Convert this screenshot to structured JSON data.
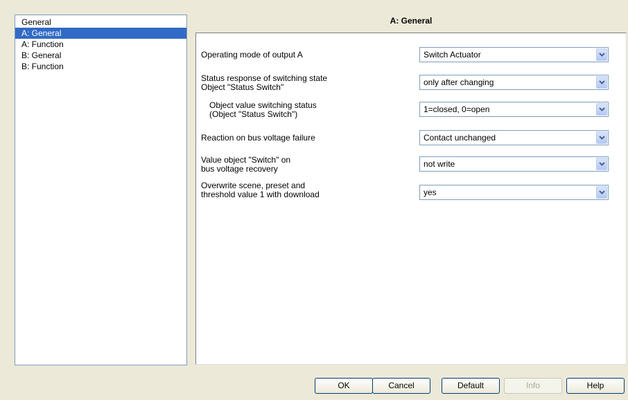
{
  "tree": {
    "items": [
      {
        "label": "General",
        "selected": false
      },
      {
        "label": "A: General",
        "selected": true
      },
      {
        "label": "A: Function",
        "selected": false
      },
      {
        "label": "B: General",
        "selected": false
      },
      {
        "label": "B: Function",
        "selected": false
      }
    ]
  },
  "page": {
    "title": "A: General"
  },
  "params": [
    {
      "label_line1": "Operating mode of output A",
      "label_line2": "",
      "value": "Switch Actuator"
    },
    {
      "label_line1": "Status response of switching state",
      "label_line2": "Object \"Status Switch\"",
      "value": "only after changing"
    },
    {
      "label_line1": "Object value switching status",
      "label_line2": "(Object \"Status Switch\")",
      "value": "1=closed, 0=open"
    },
    {
      "label_line1": "Reaction on bus voltage failure",
      "label_line2": "",
      "value": "Contact unchanged"
    },
    {
      "label_line1": "Value object \"Switch\" on",
      "label_line2": "bus voltage recovery",
      "value": "not write"
    },
    {
      "label_line1": "Overwrite scene, preset and",
      "label_line2": "threshold value 1 with download",
      "value": "yes"
    }
  ],
  "buttons": {
    "ok": "OK",
    "cancel": "Cancel",
    "default": "Default",
    "info": "Info",
    "help": "Help"
  },
  "colors": {
    "selection": "#316ac5",
    "background": "#ece9d8"
  },
  "icons": {
    "dropdown": "chevron-down-icon"
  }
}
